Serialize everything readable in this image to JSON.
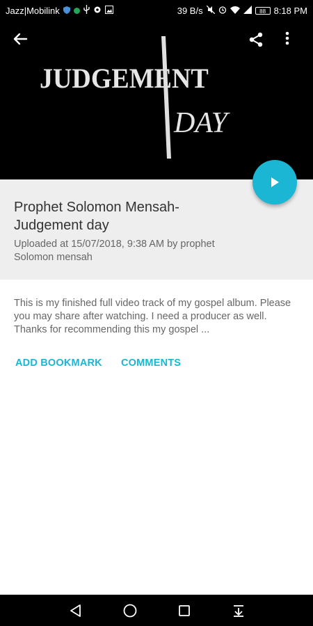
{
  "status_bar": {
    "carrier": "Jazz|Mobilink",
    "net_speed": "39 B/s",
    "battery": "88",
    "time": "8:18 PM"
  },
  "hero": {
    "title_line1": "JUDGEMENT",
    "title_line2": "DAY"
  },
  "video": {
    "title": "Prophet Solomon Mensah-Judgement day",
    "upload_info": "Uploaded at 15/07/2018, 9:38 AM by prophet Solomon mensah",
    "description": "This is my finished full video track of my gospel album. Please you may share after watching. I need a producer as well. Thanks for recommending this my gospel ..."
  },
  "actions": {
    "bookmark_label": "ADD BOOKMARK",
    "comments_label": "COMMENTS"
  },
  "icons": {
    "back": "arrow-left-icon",
    "share": "share-icon",
    "more": "more-vert-icon",
    "play": "play-icon"
  },
  "colors": {
    "accent": "#1ab6d3",
    "panel": "#eeeeee"
  }
}
